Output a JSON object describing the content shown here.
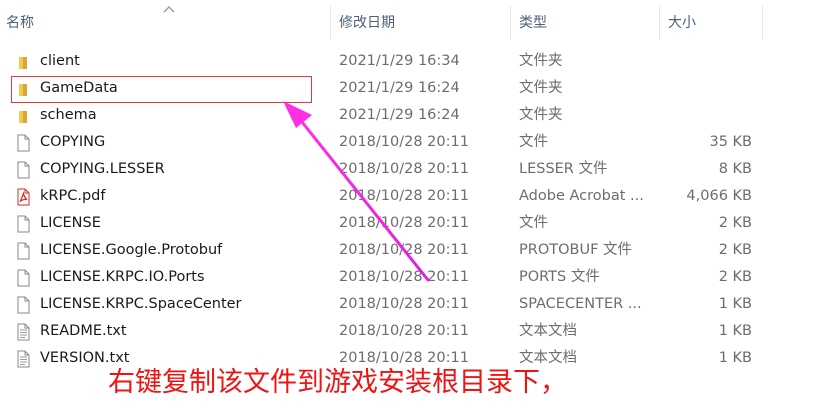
{
  "columns": {
    "name": "名称",
    "date": "修改日期",
    "type": "类型",
    "size": "大小"
  },
  "files": [
    {
      "name": "client",
      "date": "2021/1/29 16:34",
      "type": "文件夹",
      "size": "",
      "icon": "folder-icon"
    },
    {
      "name": "GameData",
      "date": "2021/1/29 16:24",
      "type": "文件夹",
      "size": "",
      "icon": "folder-icon"
    },
    {
      "name": "schema",
      "date": "2021/1/29 16:24",
      "type": "文件夹",
      "size": "",
      "icon": "folder-icon"
    },
    {
      "name": "COPYING",
      "date": "2018/10/28 20:11",
      "type": "文件",
      "size": "35 KB",
      "icon": "file-icon"
    },
    {
      "name": "COPYING.LESSER",
      "date": "2018/10/28 20:11",
      "type": "LESSER 文件",
      "size": "8 KB",
      "icon": "file-icon"
    },
    {
      "name": "kRPC.pdf",
      "date": "2018/10/28 20:11",
      "type": "Adobe Acrobat ...",
      "size": "4,066 KB",
      "icon": "pdf-icon"
    },
    {
      "name": "LICENSE",
      "date": "2018/10/28 20:11",
      "type": "文件",
      "size": "2 KB",
      "icon": "file-icon"
    },
    {
      "name": "LICENSE.Google.Protobuf",
      "date": "2018/10/28 20:11",
      "type": "PROTOBUF 文件",
      "size": "2 KB",
      "icon": "file-icon"
    },
    {
      "name": "LICENSE.KRPC.IO.Ports",
      "date": "2018/10/28 20:11",
      "type": "PORTS 文件",
      "size": "2 KB",
      "icon": "file-icon"
    },
    {
      "name": "LICENSE.KRPC.SpaceCenter",
      "date": "2018/10/28 20:11",
      "type": "SPACECENTER ...",
      "size": "1 KB",
      "icon": "file-icon"
    },
    {
      "name": "README.txt",
      "date": "2018/10/28 20:11",
      "type": "文本文档",
      "size": "1 KB",
      "icon": "text-file-icon"
    },
    {
      "name": "VERSION.txt",
      "date": "2018/10/28 20:11",
      "type": "文本文档",
      "size": "1 KB",
      "icon": "text-file-icon"
    }
  ],
  "annotation": {
    "caption": "右键复制该文件到游戏安装根目录下，",
    "highlight_color": "#e23b3b",
    "arrow_color": "#ee2ee8",
    "caption_color": "#ef1414"
  }
}
